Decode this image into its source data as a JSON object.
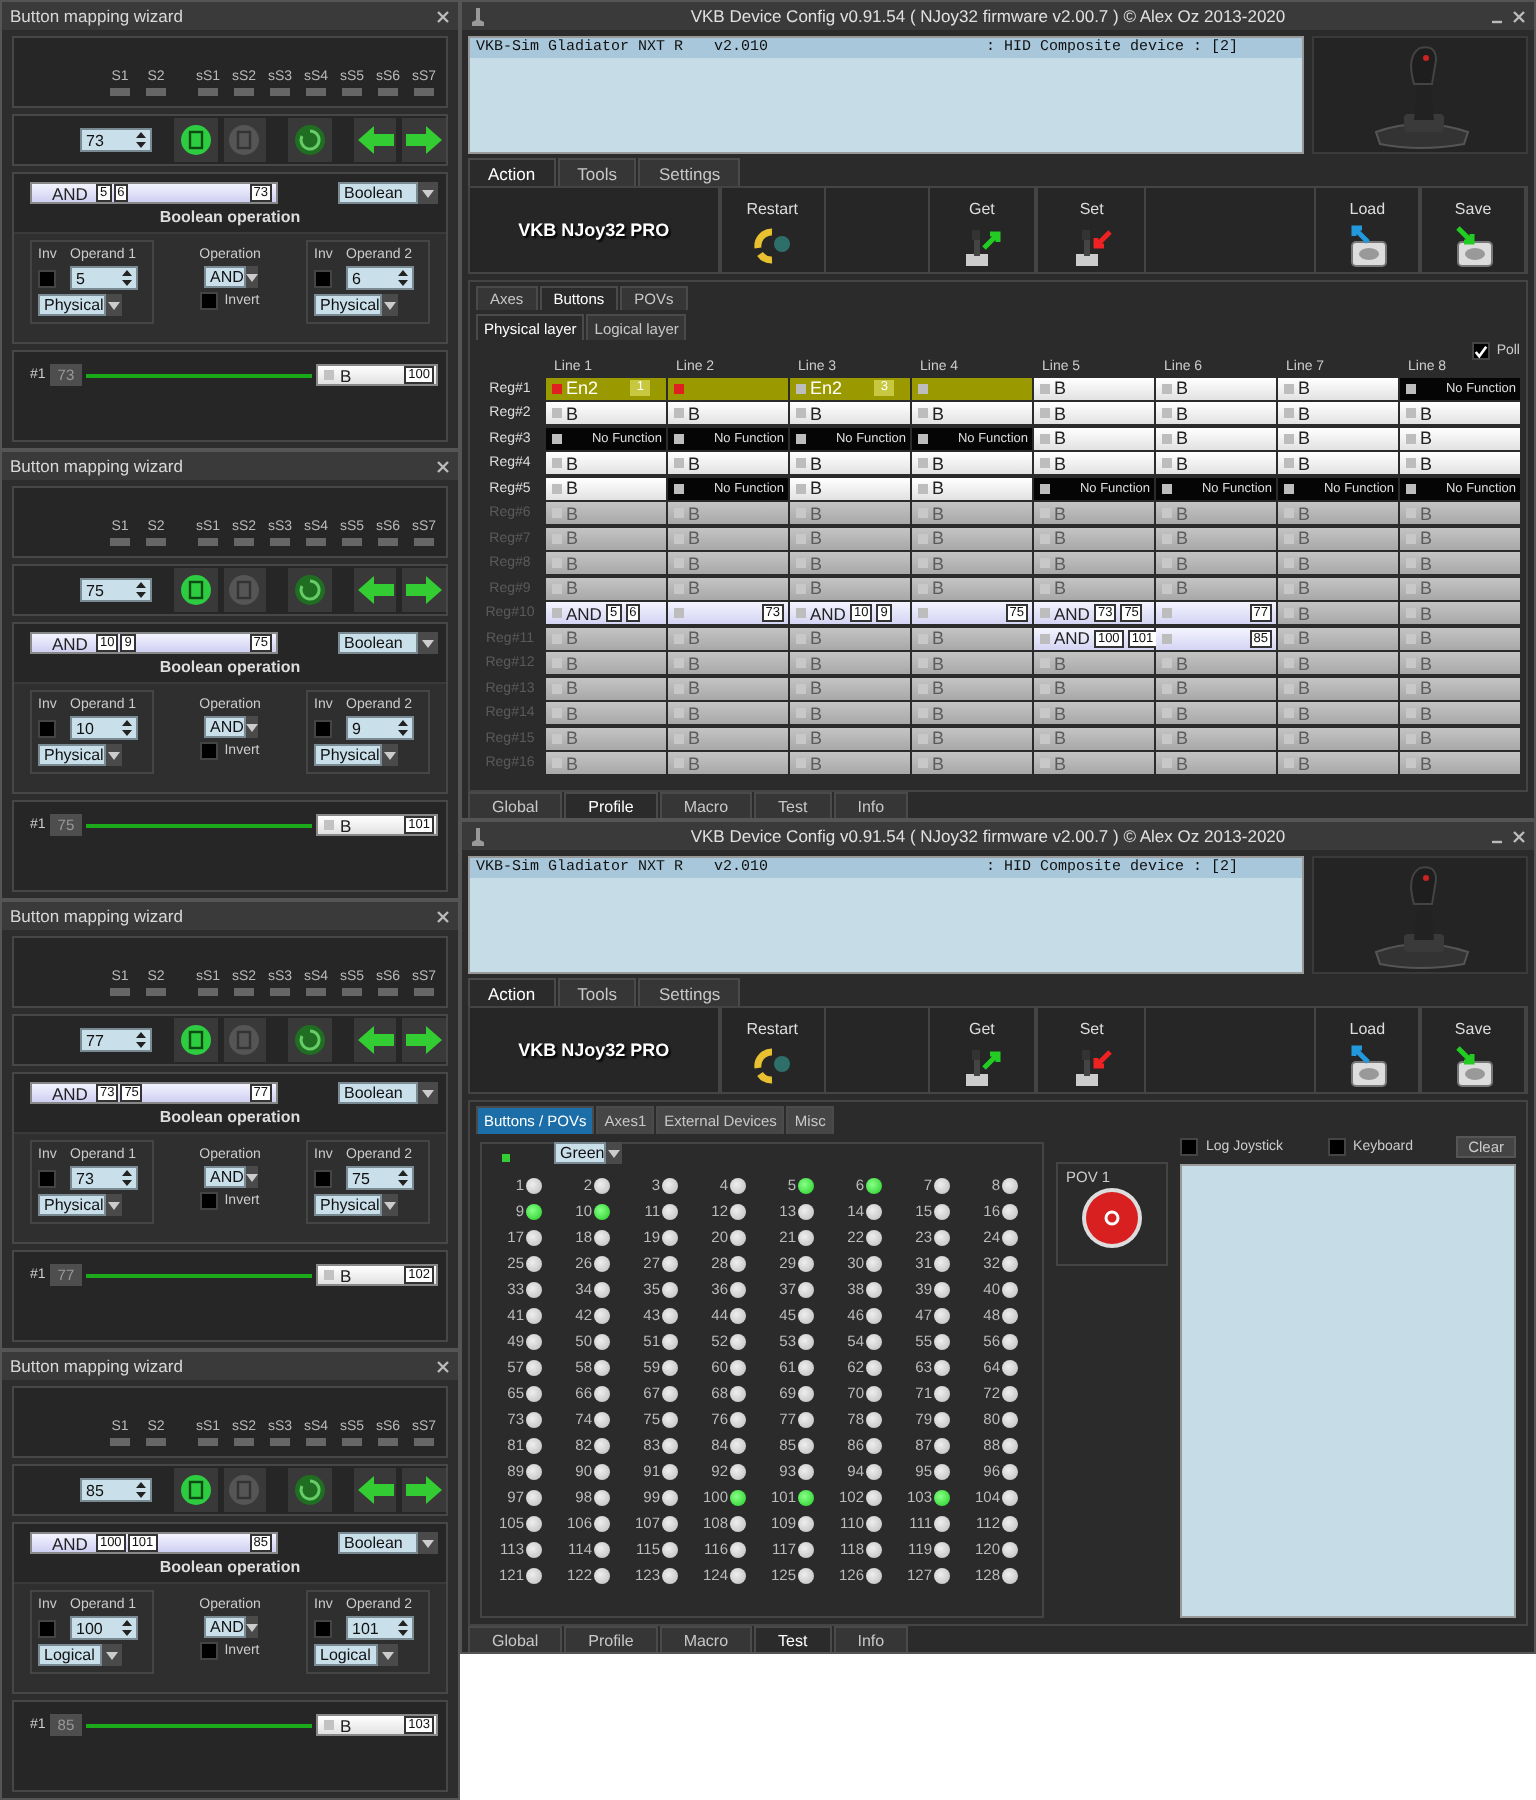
{
  "wizards": [
    {
      "title": "Button mapping wizard",
      "shifts": [
        "S1",
        "S2"
      ],
      "subshifts": [
        "sS1",
        "sS2",
        "sS3",
        "sS4",
        "sS5",
        "sS6",
        "sS7"
      ],
      "button": "73",
      "bar": {
        "operation": "AND",
        "operands": [
          "5",
          "6"
        ],
        "result": "73"
      },
      "mode": "Boolean",
      "section_title": "Boolean operation",
      "operand1": {
        "inv_label": "Inv",
        "label": "Operand 1",
        "value": "5",
        "source": "Physical",
        "inverted": false
      },
      "operation": {
        "label": "Operation",
        "value": "AND",
        "invert_label": "Invert",
        "invert": false
      },
      "operand2": {
        "inv_label": "Inv",
        "label": "Operand 2",
        "value": "6",
        "source": "Physical",
        "inverted": false
      },
      "mapping": {
        "slot": "#1",
        "button": "73",
        "function": "B",
        "target": "100"
      }
    },
    {
      "title": "Button mapping wizard",
      "shifts": [
        "S1",
        "S2"
      ],
      "subshifts": [
        "sS1",
        "sS2",
        "sS3",
        "sS4",
        "sS5",
        "sS6",
        "sS7"
      ],
      "button": "75",
      "bar": {
        "operation": "AND",
        "operands": [
          "10",
          "9"
        ],
        "result": "75"
      },
      "mode": "Boolean",
      "section_title": "Boolean operation",
      "operand1": {
        "inv_label": "Inv",
        "label": "Operand 1",
        "value": "10",
        "source": "Physical",
        "inverted": false
      },
      "operation": {
        "label": "Operation",
        "value": "AND",
        "invert_label": "Invert",
        "invert": false
      },
      "operand2": {
        "inv_label": "Inv",
        "label": "Operand 2",
        "value": "9",
        "source": "Physical",
        "inverted": false
      },
      "mapping": {
        "slot": "#1",
        "button": "75",
        "function": "B",
        "target": "101"
      }
    },
    {
      "title": "Button mapping wizard",
      "shifts": [
        "S1",
        "S2"
      ],
      "subshifts": [
        "sS1",
        "sS2",
        "sS3",
        "sS4",
        "sS5",
        "sS6",
        "sS7"
      ],
      "button": "77",
      "bar": {
        "operation": "AND",
        "operands": [
          "73",
          "75"
        ],
        "result": "77"
      },
      "mode": "Boolean",
      "section_title": "Boolean operation",
      "operand1": {
        "inv_label": "Inv",
        "label": "Operand 1",
        "value": "73",
        "source": "Physical",
        "inverted": false
      },
      "operation": {
        "label": "Operation",
        "value": "AND",
        "invert_label": "Invert",
        "invert": false
      },
      "operand2": {
        "inv_label": "Inv",
        "label": "Operand 2",
        "value": "75",
        "source": "Physical",
        "inverted": false
      },
      "mapping": {
        "slot": "#1",
        "button": "77",
        "function": "B",
        "target": "102"
      }
    },
    {
      "title": "Button mapping wizard",
      "shifts": [
        "S1",
        "S2"
      ],
      "subshifts": [
        "sS1",
        "sS2",
        "sS3",
        "sS4",
        "sS5",
        "sS6",
        "sS7"
      ],
      "button": "85",
      "bar": {
        "operation": "AND",
        "operands": [
          "100",
          "101"
        ],
        "result": "85"
      },
      "mode": "Boolean",
      "section_title": "Boolean operation",
      "operand1": {
        "inv_label": "Inv",
        "label": "Operand 1",
        "value": "100",
        "source": "Logical",
        "inverted": false
      },
      "operation": {
        "label": "Operation",
        "value": "AND",
        "invert_label": "Invert",
        "invert": false
      },
      "operand2": {
        "inv_label": "Inv",
        "label": "Operand 2",
        "value": "101",
        "source": "Logical",
        "inverted": false
      },
      "mapping": {
        "slot": "#1",
        "button": "85",
        "function": "B",
        "target": "103"
      }
    }
  ],
  "config_window": {
    "title": "VKB Device Config v0.91.54 ( NJoy32 firmware v2.00.7 ) © Alex Oz 2013-2020",
    "devices": [
      {
        "name": "VKB-Sim Gladiator NXT R",
        "version": "v2.010",
        "type": ": HID Composite device : [2]",
        "selected": true
      }
    ],
    "tabs": [
      {
        "label": "Action",
        "selected": true
      },
      {
        "label": "Tools",
        "selected": false
      },
      {
        "label": "Settings",
        "selected": false
      }
    ],
    "toolbar": {
      "device": "VKB NJoy32 PRO",
      "buttons": [
        {
          "kind": "restart",
          "label": "Restart"
        },
        {
          "kind": "get",
          "label": "Get"
        },
        {
          "kind": "set",
          "label": "Set"
        },
        {
          "kind": "load",
          "label": "Load"
        },
        {
          "kind": "save",
          "label": "Save"
        }
      ]
    },
    "section_tabs": [
      {
        "label": "Axes",
        "selected": false
      },
      {
        "label": "Buttons",
        "selected": true
      },
      {
        "label": "POVs",
        "selected": false
      }
    ],
    "layer_tabs": [
      {
        "label": "Physical layer",
        "selected": true
      },
      {
        "label": "Logical layer",
        "selected": false
      }
    ],
    "poll": {
      "label": "Poll",
      "checked": true
    },
    "columns": [
      "Line 1",
      "Line 2",
      "Line 3",
      "Line 4",
      "Line 5",
      "Line 6",
      "Line 7",
      "Line 8"
    ],
    "rows": [
      {
        "label": "Reg#1",
        "enabled": true,
        "cells": [
          {
            "kind": "enable",
            "text": "En2",
            "badge": "1",
            "active": true
          },
          {
            "kind": "enable_cont",
            "active": true
          },
          {
            "kind": "enable",
            "text": "En2",
            "badge": "3",
            "active": false
          },
          {
            "kind": "enable_cont",
            "active": false
          },
          {
            "kind": "button",
            "text": "B",
            "active": false
          },
          {
            "kind": "button",
            "text": "B",
            "active": false
          },
          {
            "kind": "button",
            "text": "B",
            "active": false
          },
          {
            "kind": "nofunc",
            "text": "No Function",
            "active": false
          }
        ]
      },
      {
        "label": "Reg#2",
        "enabled": true,
        "cells": [
          {
            "kind": "button",
            "text": "B",
            "active": false
          },
          {
            "kind": "button",
            "text": "B",
            "active": false
          },
          {
            "kind": "button",
            "text": "B",
            "active": false
          },
          {
            "kind": "button",
            "text": "B",
            "active": false
          },
          {
            "kind": "button",
            "text": "B",
            "active": false
          },
          {
            "kind": "button",
            "text": "B",
            "active": false
          },
          {
            "kind": "button",
            "text": "B",
            "active": false
          },
          {
            "kind": "button",
            "text": "B",
            "active": false
          }
        ]
      },
      {
        "label": "Reg#3",
        "enabled": true,
        "cells": [
          {
            "kind": "nofunc",
            "text": "No Function",
            "active": false
          },
          {
            "kind": "nofunc",
            "text": "No Function",
            "active": false
          },
          {
            "kind": "nofunc",
            "text": "No Function",
            "active": false
          },
          {
            "kind": "nofunc",
            "text": "No Function",
            "active": false
          },
          {
            "kind": "button",
            "text": "B",
            "active": false
          },
          {
            "kind": "button",
            "text": "B",
            "active": false
          },
          {
            "kind": "button",
            "text": "B",
            "active": false
          },
          {
            "kind": "button",
            "text": "B",
            "active": false
          }
        ]
      },
      {
        "label": "Reg#4",
        "enabled": true,
        "cells": [
          {
            "kind": "button",
            "text": "B",
            "active": false
          },
          {
            "kind": "button",
            "text": "B",
            "active": false
          },
          {
            "kind": "button",
            "text": "B",
            "active": false
          },
          {
            "kind": "button",
            "text": "B",
            "active": false
          },
          {
            "kind": "button",
            "text": "B",
            "active": false
          },
          {
            "kind": "button",
            "text": "B",
            "active": false
          },
          {
            "kind": "button",
            "text": "B",
            "active": false
          },
          {
            "kind": "button",
            "text": "B",
            "active": false
          }
        ]
      },
      {
        "label": "Reg#5",
        "enabled": true,
        "cells": [
          {
            "kind": "button",
            "text": "B",
            "active": false
          },
          {
            "kind": "nofunc",
            "text": "No Function",
            "active": false
          },
          {
            "kind": "button",
            "text": "B",
            "active": false
          },
          {
            "kind": "button",
            "text": "B",
            "active": false
          },
          {
            "kind": "nofunc",
            "text": "No Function",
            "active": false
          },
          {
            "kind": "nofunc",
            "text": "No Function",
            "active": false
          },
          {
            "kind": "nofunc",
            "text": "No Function",
            "active": false
          },
          {
            "kind": "nofunc",
            "text": "No Function",
            "active": false
          }
        ]
      },
      {
        "label": "Reg#6",
        "enabled": false,
        "cells": [
          {
            "kind": "button",
            "text": "B",
            "active": false
          },
          {
            "kind": "button",
            "text": "B",
            "active": false
          },
          {
            "kind": "button",
            "text": "B",
            "active": false
          },
          {
            "kind": "button",
            "text": "B",
            "active": false
          },
          {
            "kind": "button",
            "text": "B",
            "active": false
          },
          {
            "kind": "button",
            "text": "B",
            "active": false
          },
          {
            "kind": "button",
            "text": "B",
            "active": false
          },
          {
            "kind": "button",
            "text": "B",
            "active": false
          }
        ]
      },
      {
        "label": "Reg#7",
        "enabled": false,
        "cells": [
          {
            "kind": "button",
            "text": "B",
            "active": false
          },
          {
            "kind": "button",
            "text": "B",
            "active": false
          },
          {
            "kind": "button",
            "text": "B",
            "active": false
          },
          {
            "kind": "button",
            "text": "B",
            "active": false
          },
          {
            "kind": "button",
            "text": "B",
            "active": false
          },
          {
            "kind": "button",
            "text": "B",
            "active": false
          },
          {
            "kind": "button",
            "text": "B",
            "active": false
          },
          {
            "kind": "button",
            "text": "B",
            "active": false
          }
        ]
      },
      {
        "label": "Reg#8",
        "enabled": false,
        "cells": [
          {
            "kind": "button",
            "text": "B",
            "active": false
          },
          {
            "kind": "button",
            "text": "B",
            "active": false
          },
          {
            "kind": "button",
            "text": "B",
            "active": false
          },
          {
            "kind": "button",
            "text": "B",
            "active": false
          },
          {
            "kind": "button",
            "text": "B",
            "active": false
          },
          {
            "kind": "button",
            "text": "B",
            "active": false
          },
          {
            "kind": "button",
            "text": "B",
            "active": false
          },
          {
            "kind": "button",
            "text": "B",
            "active": false
          }
        ]
      },
      {
        "label": "Reg#9",
        "enabled": false,
        "cells": [
          {
            "kind": "button",
            "text": "B",
            "active": false
          },
          {
            "kind": "button",
            "text": "B",
            "active": false
          },
          {
            "kind": "button",
            "text": "B",
            "active": false
          },
          {
            "kind": "button",
            "text": "B",
            "active": false
          },
          {
            "kind": "button",
            "text": "B",
            "active": false
          },
          {
            "kind": "button",
            "text": "B",
            "active": false
          },
          {
            "kind": "button",
            "text": "B",
            "active": false
          },
          {
            "kind": "button",
            "text": "B",
            "active": false
          }
        ]
      },
      {
        "label": "Reg#10",
        "enabled": false,
        "cells": [
          {
            "kind": "bool",
            "op": "AND",
            "operands": [
              "5",
              "6"
            ],
            "active": false
          },
          {
            "kind": "bool_cont",
            "result": "73",
            "active": false
          },
          {
            "kind": "bool",
            "op": "AND",
            "operands": [
              "10",
              "9"
            ],
            "active": false
          },
          {
            "kind": "bool_cont",
            "result": "75",
            "active": false
          },
          {
            "kind": "bool",
            "op": "AND",
            "operands": [
              "73",
              "75"
            ],
            "active": false
          },
          {
            "kind": "bool_cont",
            "result": "77",
            "active": false
          },
          {
            "kind": "button",
            "text": "B",
            "active": false
          },
          {
            "kind": "button",
            "text": "B",
            "active": false
          }
        ]
      },
      {
        "label": "Reg#11",
        "enabled": false,
        "cells": [
          {
            "kind": "button",
            "text": "B",
            "active": false
          },
          {
            "kind": "button",
            "text": "B",
            "active": false
          },
          {
            "kind": "button",
            "text": "B",
            "active": false
          },
          {
            "kind": "button",
            "text": "B",
            "active": false
          },
          {
            "kind": "bool",
            "op": "AND",
            "operands": [
              "100",
              "101"
            ],
            "active": false
          },
          {
            "kind": "bool_cont",
            "result": "85",
            "active": false
          },
          {
            "kind": "button",
            "text": "B",
            "active": false
          },
          {
            "kind": "button",
            "text": "B",
            "active": false
          }
        ]
      },
      {
        "label": "Reg#12",
        "enabled": false,
        "cells": [
          {
            "kind": "button",
            "text": "B",
            "active": false
          },
          {
            "kind": "button",
            "text": "B",
            "active": false
          },
          {
            "kind": "button",
            "text": "B",
            "active": false
          },
          {
            "kind": "button",
            "text": "B",
            "active": false
          },
          {
            "kind": "button",
            "text": "B",
            "active": false
          },
          {
            "kind": "button",
            "text": "B",
            "active": false
          },
          {
            "kind": "button",
            "text": "B",
            "active": false
          },
          {
            "kind": "button",
            "text": "B",
            "active": false
          }
        ]
      },
      {
        "label": "Reg#13",
        "enabled": false,
        "cells": [
          {
            "kind": "button",
            "text": "B",
            "active": false
          },
          {
            "kind": "button",
            "text": "B",
            "active": false
          },
          {
            "kind": "button",
            "text": "B",
            "active": false
          },
          {
            "kind": "button",
            "text": "B",
            "active": false
          },
          {
            "kind": "button",
            "text": "B",
            "active": false
          },
          {
            "kind": "button",
            "text": "B",
            "active": false
          },
          {
            "kind": "button",
            "text": "B",
            "active": false
          },
          {
            "kind": "button",
            "text": "B",
            "active": false
          }
        ]
      },
      {
        "label": "Reg#14",
        "enabled": false,
        "cells": [
          {
            "kind": "button",
            "text": "B",
            "active": false
          },
          {
            "kind": "button",
            "text": "B",
            "active": false
          },
          {
            "kind": "button",
            "text": "B",
            "active": false
          },
          {
            "kind": "button",
            "text": "B",
            "active": false
          },
          {
            "kind": "button",
            "text": "B",
            "active": false
          },
          {
            "kind": "button",
            "text": "B",
            "active": false
          },
          {
            "kind": "button",
            "text": "B",
            "active": false
          },
          {
            "kind": "button",
            "text": "B",
            "active": false
          }
        ]
      },
      {
        "label": "Reg#15",
        "enabled": false,
        "cells": [
          {
            "kind": "button",
            "text": "B",
            "active": false
          },
          {
            "kind": "button",
            "text": "B",
            "active": false
          },
          {
            "kind": "button",
            "text": "B",
            "active": false
          },
          {
            "kind": "button",
            "text": "B",
            "active": false
          },
          {
            "kind": "button",
            "text": "B",
            "active": false
          },
          {
            "kind": "button",
            "text": "B",
            "active": false
          },
          {
            "kind": "button",
            "text": "B",
            "active": false
          },
          {
            "kind": "button",
            "text": "B",
            "active": false
          }
        ]
      },
      {
        "label": "Reg#16",
        "enabled": false,
        "cells": [
          {
            "kind": "button",
            "text": "B",
            "active": false
          },
          {
            "kind": "button",
            "text": "B",
            "active": false
          },
          {
            "kind": "button",
            "text": "B",
            "active": false
          },
          {
            "kind": "button",
            "text": "B",
            "active": false
          },
          {
            "kind": "button",
            "text": "B",
            "active": false
          },
          {
            "kind": "button",
            "text": "B",
            "active": false
          },
          {
            "kind": "button",
            "text": "B",
            "active": false
          },
          {
            "kind": "button",
            "text": "B",
            "active": false
          }
        ]
      }
    ],
    "bottom_tabs": [
      {
        "label": "Global",
        "selected": false
      },
      {
        "label": "Profile",
        "selected": true
      },
      {
        "label": "Macro",
        "selected": false
      },
      {
        "label": "Test",
        "selected": false
      },
      {
        "label": "Info",
        "selected": false
      }
    ]
  },
  "test_window": {
    "title": "VKB Device Config v0.91.54 ( NJoy32 firmware v2.00.7 ) © Alex Oz 2013-2020",
    "devices": [
      {
        "name": "VKB-Sim Gladiator NXT R",
        "version": "v2.010",
        "type": ": HID Composite device : [2]",
        "selected": true
      }
    ],
    "tabs": [
      {
        "label": "Action",
        "selected": true
      },
      {
        "label": "Tools",
        "selected": false
      },
      {
        "label": "Settings",
        "selected": false
      }
    ],
    "toolbar": {
      "device": "VKB NJoy32 PRO",
      "buttons": [
        {
          "kind": "restart",
          "label": "Restart"
        },
        {
          "kind": "get",
          "label": "Get"
        },
        {
          "kind": "set",
          "label": "Set"
        },
        {
          "kind": "load",
          "label": "Load"
        },
        {
          "kind": "save",
          "label": "Save"
        }
      ]
    },
    "test_tabs": [
      {
        "label": "Buttons / POVs",
        "selected": true
      },
      {
        "label": "Axes1",
        "selected": false
      },
      {
        "label": "External Devices",
        "selected": false
      },
      {
        "label": "Misc",
        "selected": false
      }
    ],
    "color_select": "Green",
    "button_rows": [
      [
        {
          "label": "1",
          "on": false
        },
        {
          "label": "2",
          "on": false
        },
        {
          "label": "3",
          "on": false
        },
        {
          "label": "4",
          "on": false
        },
        {
          "label": "5",
          "on": true
        },
        {
          "label": "6",
          "on": true
        },
        {
          "label": "7",
          "on": false
        },
        {
          "label": "8",
          "on": false
        }
      ],
      [
        {
          "label": "9",
          "on": true
        },
        {
          "label": "10",
          "on": true
        },
        {
          "label": "11",
          "on": false
        },
        {
          "label": "12",
          "on": false
        },
        {
          "label": "13",
          "on": false
        },
        {
          "label": "14",
          "on": false
        },
        {
          "label": "15",
          "on": false
        },
        {
          "label": "16",
          "on": false
        }
      ],
      [
        {
          "label": "17",
          "on": false
        },
        {
          "label": "18",
          "on": false
        },
        {
          "label": "19",
          "on": false
        },
        {
          "label": "20",
          "on": false
        },
        {
          "label": "21",
          "on": false
        },
        {
          "label": "22",
          "on": false
        },
        {
          "label": "23",
          "on": false
        },
        {
          "label": "24",
          "on": false
        }
      ],
      [
        {
          "label": "25",
          "on": false
        },
        {
          "label": "26",
          "on": false
        },
        {
          "label": "27",
          "on": false
        },
        {
          "label": "28",
          "on": false
        },
        {
          "label": "29",
          "on": false
        },
        {
          "label": "30",
          "on": false
        },
        {
          "label": "31",
          "on": false
        },
        {
          "label": "32",
          "on": false
        }
      ],
      [
        {
          "label": "33",
          "on": false
        },
        {
          "label": "34",
          "on": false
        },
        {
          "label": "35",
          "on": false
        },
        {
          "label": "36",
          "on": false
        },
        {
          "label": "37",
          "on": false
        },
        {
          "label": "38",
          "on": false
        },
        {
          "label": "39",
          "on": false
        },
        {
          "label": "40",
          "on": false
        }
      ],
      [
        {
          "label": "41",
          "on": false
        },
        {
          "label": "42",
          "on": false
        },
        {
          "label": "43",
          "on": false
        },
        {
          "label": "44",
          "on": false
        },
        {
          "label": "45",
          "on": false
        },
        {
          "label": "46",
          "on": false
        },
        {
          "label": "47",
          "on": false
        },
        {
          "label": "48",
          "on": false
        }
      ],
      [
        {
          "label": "49",
          "on": false
        },
        {
          "label": "50",
          "on": false
        },
        {
          "label": "51",
          "on": false
        },
        {
          "label": "52",
          "on": false
        },
        {
          "label": "53",
          "on": false
        },
        {
          "label": "54",
          "on": false
        },
        {
          "label": "55",
          "on": false
        },
        {
          "label": "56",
          "on": false
        }
      ],
      [
        {
          "label": "57",
          "on": false
        },
        {
          "label": "58",
          "on": false
        },
        {
          "label": "59",
          "on": false
        },
        {
          "label": "60",
          "on": false
        },
        {
          "label": "61",
          "on": false
        },
        {
          "label": "62",
          "on": false
        },
        {
          "label": "63",
          "on": false
        },
        {
          "label": "64",
          "on": false
        }
      ],
      [
        {
          "label": "65",
          "on": false
        },
        {
          "label": "66",
          "on": false
        },
        {
          "label": "67",
          "on": false
        },
        {
          "label": "68",
          "on": false
        },
        {
          "label": "69",
          "on": false
        },
        {
          "label": "70",
          "on": false
        },
        {
          "label": "71",
          "on": false
        },
        {
          "label": "72",
          "on": false
        }
      ],
      [
        {
          "label": "73",
          "on": false
        },
        {
          "label": "74",
          "on": false
        },
        {
          "label": "75",
          "on": false
        },
        {
          "label": "76",
          "on": false
        },
        {
          "label": "77",
          "on": false
        },
        {
          "label": "78",
          "on": false
        },
        {
          "label": "79",
          "on": false
        },
        {
          "label": "80",
          "on": false
        }
      ],
      [
        {
          "label": "81",
          "on": false
        },
        {
          "label": "82",
          "on": false
        },
        {
          "label": "83",
          "on": false
        },
        {
          "label": "84",
          "on": false
        },
        {
          "label": "85",
          "on": false
        },
        {
          "label": "86",
          "on": false
        },
        {
          "label": "87",
          "on": false
        },
        {
          "label": "88",
          "on": false
        }
      ],
      [
        {
          "label": "89",
          "on": false
        },
        {
          "label": "90",
          "on": false
        },
        {
          "label": "91",
          "on": false
        },
        {
          "label": "92",
          "on": false
        },
        {
          "label": "93",
          "on": false
        },
        {
          "label": "94",
          "on": false
        },
        {
          "label": "95",
          "on": false
        },
        {
          "label": "96",
          "on": false
        }
      ],
      [
        {
          "label": "97",
          "on": false
        },
        {
          "label": "98",
          "on": false
        },
        {
          "label": "99",
          "on": false
        },
        {
          "label": "100",
          "on": true
        },
        {
          "label": "101",
          "on": true
        },
        {
          "label": "102",
          "on": false
        },
        {
          "label": "103",
          "on": true
        },
        {
          "label": "104",
          "on": false
        }
      ],
      [
        {
          "label": "105",
          "on": false
        },
        {
          "label": "106",
          "on": false
        },
        {
          "label": "107",
          "on": false
        },
        {
          "label": "108",
          "on": false
        },
        {
          "label": "109",
          "on": false
        },
        {
          "label": "110",
          "on": false
        },
        {
          "label": "111",
          "on": false
        },
        {
          "label": "112",
          "on": false
        }
      ],
      [
        {
          "label": "113",
          "on": false
        },
        {
          "label": "114",
          "on": false
        },
        {
          "label": "115",
          "on": false
        },
        {
          "label": "116",
          "on": false
        },
        {
          "label": "117",
          "on": false
        },
        {
          "label": "118",
          "on": false
        },
        {
          "label": "119",
          "on": false
        },
        {
          "label": "120",
          "on": false
        }
      ],
      [
        {
          "label": "121",
          "on": false
        },
        {
          "label": "122",
          "on": false
        },
        {
          "label": "123",
          "on": false
        },
        {
          "label": "124",
          "on": false
        },
        {
          "label": "125",
          "on": false
        },
        {
          "label": "126",
          "on": false
        },
        {
          "label": "127",
          "on": false
        },
        {
          "label": "128",
          "on": false
        }
      ]
    ],
    "pov": {
      "label": "POV 1"
    },
    "log_joystick": {
      "label": "Log Joystick",
      "checked": false
    },
    "keyboard": {
      "label": "Keyboard",
      "checked": false
    },
    "clear": "Clear",
    "bottom_tabs": [
      {
        "label": "Global",
        "selected": false
      },
      {
        "label": "Profile",
        "selected": false
      },
      {
        "label": "Macro",
        "selected": false
      },
      {
        "label": "Test",
        "selected": true
      },
      {
        "label": "Info",
        "selected": false
      }
    ]
  }
}
